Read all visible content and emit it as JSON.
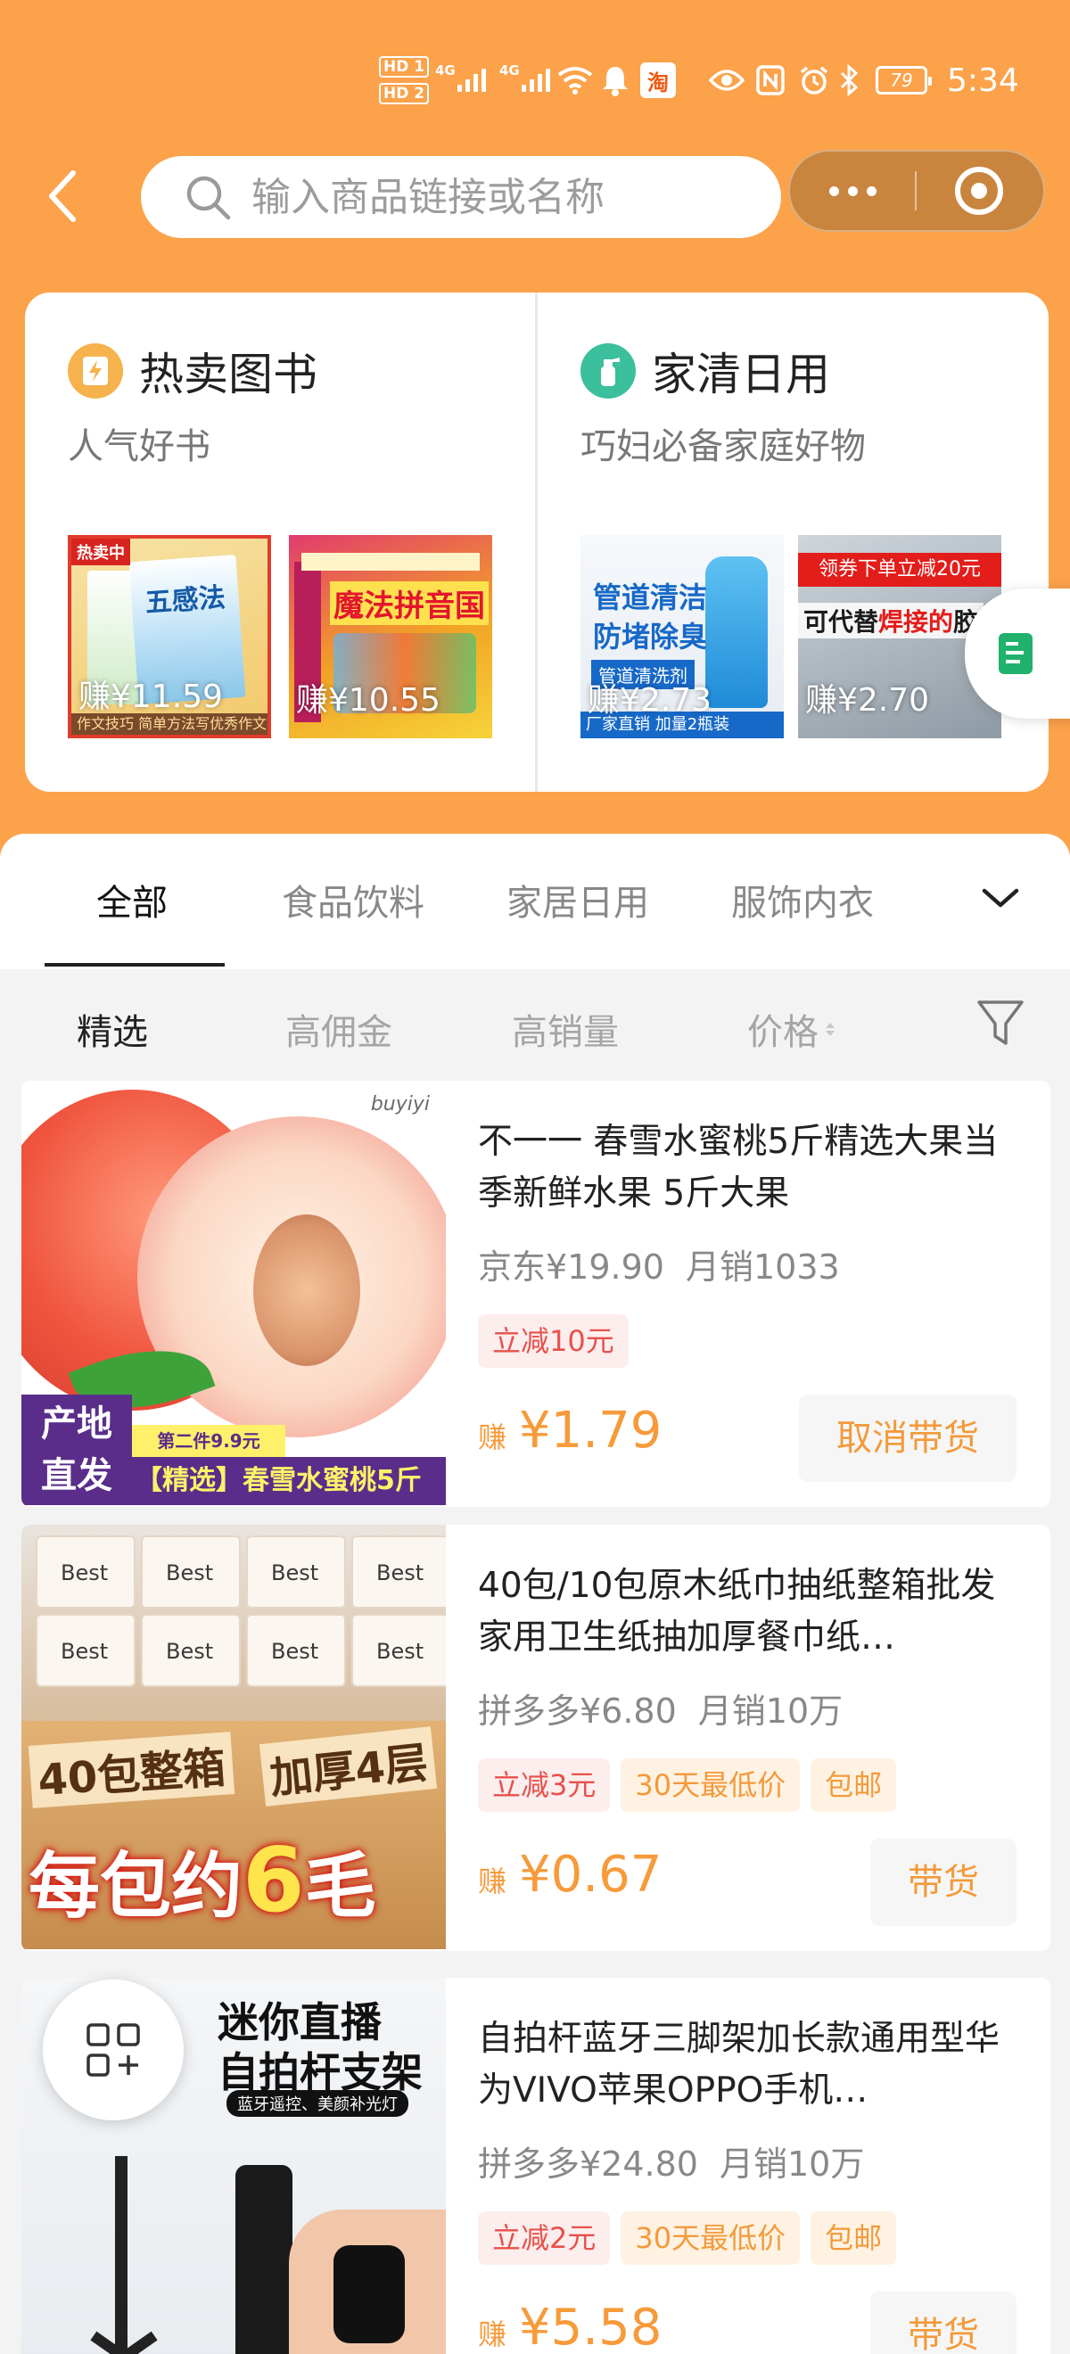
{
  "status_bar": {
    "hd1": "HD 1",
    "hd2": "HD 2",
    "net1": "4G",
    "net2": "4G",
    "taobao_badge": "淘",
    "battery": "79",
    "time": "5:34"
  },
  "header": {
    "search_placeholder": "输入商品链接或名称"
  },
  "promo": [
    {
      "title": "热卖图书",
      "subtitle": "人气好书",
      "icon": "lightning-book-icon",
      "icon_color": "#f6b24c",
      "items": [
        {
          "earn": "赚¥11.59",
          "hot_tag": "热卖中",
          "cover_text": "五感法",
          "strip_text": "作文技巧  简单方法写优秀作文"
        },
        {
          "earn": "赚¥10.55",
          "cover_title": "魔法拼音国"
        }
      ]
    },
    {
      "title": "家清日用",
      "subtitle": "巧妇必备家庭好物",
      "icon": "spray-bottle-icon",
      "icon_color": "#3bbf9c",
      "items": [
        {
          "earn": "赚¥2.73",
          "headline": "管道清洁\n防堵除臭",
          "pill": "管道清洗剂",
          "strip_text": "厂家直销 加量2瓶装"
        },
        {
          "earn": "赚¥2.70",
          "red_banner": "领券下单立减20元",
          "white_text_a": "可代替",
          "white_text_b": "焊接的",
          "white_text_c": "胶"
        }
      ]
    }
  ],
  "tabs": [
    "全部",
    "食品饮料",
    "家居日用",
    "服饰内衣"
  ],
  "active_tab": "全部",
  "sort_options": [
    "精选",
    "高佣金",
    "高销量",
    "价格"
  ],
  "active_sort": "精选",
  "products": [
    {
      "title": "不一一 春雪水蜜桃5斤精选大果当季新鲜水果 5斤大果",
      "platform_price": "京东¥19.90",
      "sales": "月销1033",
      "tags": [
        {
          "text": "立减10元",
          "style": "red"
        }
      ],
      "earn_prefix": "赚",
      "earn_value": "¥1.79",
      "action": "取消带货",
      "image": {
        "brand": "buyiyi",
        "origin": "产地\n直发",
        "second": "第二件9.9元",
        "banner": "【精选】春雪水蜜桃5斤"
      }
    },
    {
      "title": "40包/10包原木纸巾抽纸整箱批发家用卫生纸抽加厚餐巾纸…",
      "platform_price": "拼多多¥6.80",
      "sales": "月销10万",
      "tags": [
        {
          "text": "立减3元",
          "style": "red"
        },
        {
          "text": "30天最低价",
          "style": "orange"
        },
        {
          "text": "包邮",
          "style": "orange"
        }
      ],
      "earn_prefix": "赚",
      "earn_value": "¥0.67",
      "action": "带货",
      "image": {
        "pack_label": "Best",
        "label1": "40包整箱",
        "label2": "加厚4层",
        "big_a": "每包约",
        "big_b": "6",
        "big_c": "毛"
      }
    },
    {
      "title": "自拍杆蓝牙三脚架加长款通用型华为VIVO苹果OPPO手机…",
      "platform_price": "拼多多¥24.80",
      "sales": "月销10万",
      "tags": [
        {
          "text": "立减2元",
          "style": "red"
        },
        {
          "text": "30天最低价",
          "style": "orange"
        },
        {
          "text": "包邮",
          "style": "orange"
        }
      ],
      "earn_prefix": "赚",
      "earn_value": "¥5.58",
      "action": "带货",
      "image": {
        "line1": "迷你直播",
        "line2": "自拍杆支架",
        "line3": "蓝牙遥控、美颜补光灯"
      }
    }
  ],
  "colors": {
    "brand_orange": "#fba24a",
    "price_orange": "#f79a3a",
    "tag_red": "#e8514b"
  }
}
